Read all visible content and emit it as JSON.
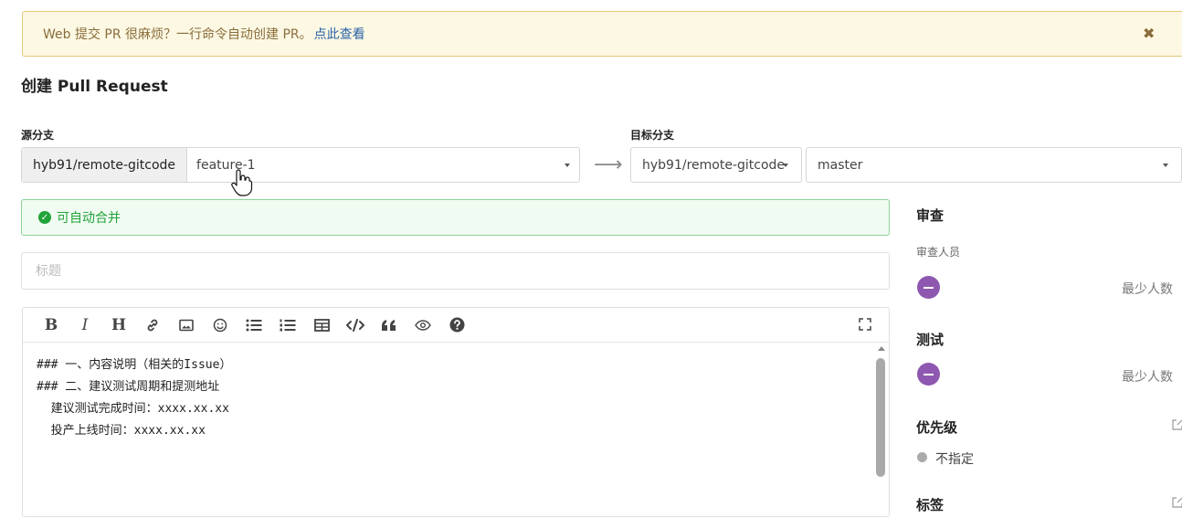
{
  "banner": {
    "text": "Web 提交 PR 很麻烦？一行命令自动创建 PR。",
    "link": "点此查看",
    "close_icon": "close-icon"
  },
  "page_title": "创建 Pull Request",
  "source": {
    "label": "源分支",
    "repo": "hyb91/remote-gitcode",
    "branch": "feature-1"
  },
  "target": {
    "label": "目标分支",
    "repo": "hyb91/remote-gitcode",
    "branch": "master"
  },
  "arrow": "⟶",
  "merge_status": "可自动合并",
  "title_placeholder": "标题",
  "toolbar": {
    "bold": "B",
    "italic": "I",
    "heading": "H"
  },
  "editor": {
    "lines": [
      "### 一、内容说明（相关的Issue）",
      "",
      "",
      "",
      "### 二、建议测试周期和提测地址",
      "  建议测试完成时间：xxxx.xx.xx",
      "  投产上线时间：xxxx.xx.xx"
    ]
  },
  "sidebar": {
    "review_title": "审查",
    "reviewer_label": "审查人员",
    "reviewer_min": "最少人数",
    "test_title": "测试",
    "test_min": "最少人数",
    "priority_title": "优先级",
    "priority_value": "不指定",
    "tags_title": "标签"
  },
  "colors": {
    "banner_bg": "#fcf8e3",
    "success": "#21a33a",
    "avatar": "#8e58b0"
  }
}
